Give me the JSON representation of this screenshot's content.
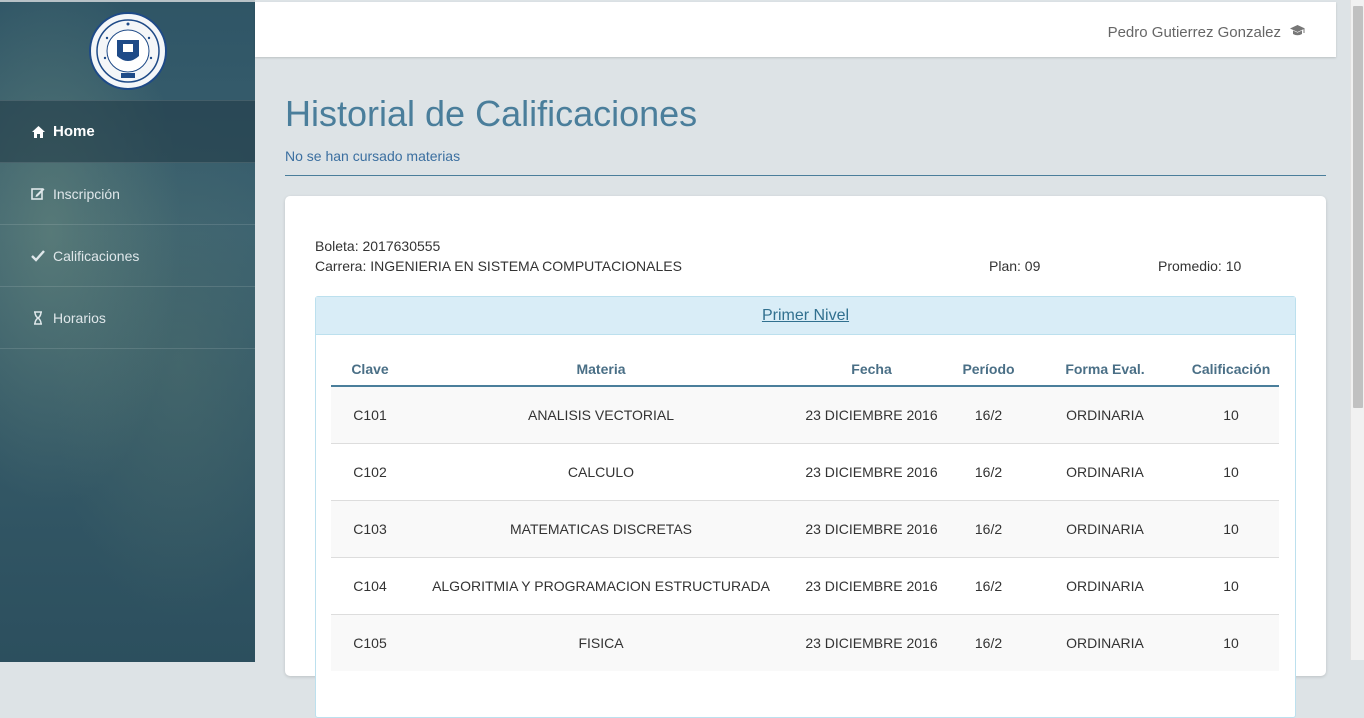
{
  "sidebar": {
    "items": [
      {
        "label": "Home",
        "icon": "home-icon"
      },
      {
        "label": "Inscripción",
        "icon": "edit-icon"
      },
      {
        "label": "Calificaciones",
        "icon": "check-icon"
      },
      {
        "label": "Horarios",
        "icon": "hourglass-icon"
      }
    ]
  },
  "header": {
    "user_name": "Pedro Gutierrez Gonzalez",
    "user_icon": "graduation-cap-icon"
  },
  "main": {
    "title": "Historial de Calificaciones",
    "subtitle": "No se han cursado materias"
  },
  "student": {
    "boleta_label": "Boleta: 2017630555",
    "carrera_label": "Carrera: INGENIERIA EN SISTEMA COMPUTACIONALES",
    "plan_label": "Plan: 09",
    "promedio_label": "Promedio: 10"
  },
  "panel": {
    "title": "Primer Nivel"
  },
  "table": {
    "headers": [
      "Clave",
      "Materia",
      "Fecha",
      "Período",
      "Forma Eval.",
      "Calificación"
    ],
    "rows": [
      [
        "C101",
        "ANALISIS VECTORIAL",
        "23 DICIEMBRE 2016",
        "16/2",
        "ORDINARIA",
        "10"
      ],
      [
        "C102",
        "CALCULO",
        "23 DICIEMBRE 2016",
        "16/2",
        "ORDINARIA",
        "10"
      ],
      [
        "C103",
        "MATEMATICAS DISCRETAS",
        "23 DICIEMBRE 2016",
        "16/2",
        "ORDINARIA",
        "10"
      ],
      [
        "C104",
        "ALGORITMIA Y PROGRAMACION ESTRUCTURADA",
        "23 DICIEMBRE 2016",
        "16/2",
        "ORDINARIA",
        "10"
      ],
      [
        "C105",
        "FISICA",
        "23 DICIEMBRE 2016",
        "16/2",
        "ORDINARIA",
        "10"
      ]
    ]
  }
}
